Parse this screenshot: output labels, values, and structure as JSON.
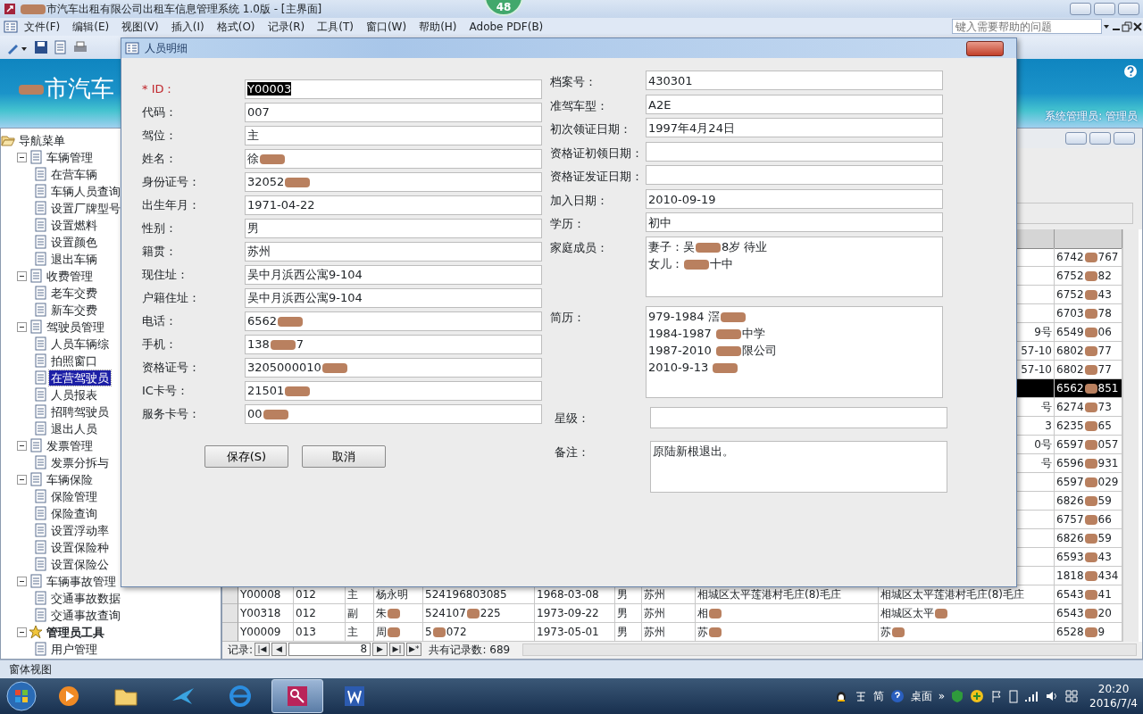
{
  "window": {
    "title": [
      {
        "kind": "redaction"
      },
      "市汽车出租有限公司出租车信息管理系统 1.0版 - [主界面]"
    ],
    "badge": "48"
  },
  "menu": [
    "文件(F)",
    "编辑(E)",
    "视图(V)",
    "插入(I)",
    "格式(O)",
    "记录(R)",
    "工具(T)",
    "窗口(W)",
    "帮助(H)",
    "Adobe PDF(B)"
  ],
  "help_box": {
    "placeholder": "键入需要帮助的问题"
  },
  "banner": {
    "title": [
      {
        "kind": "redaction"
      },
      "市汽车"
    ],
    "user": "系统管理员: 管理员"
  },
  "nav": {
    "label": "导航菜单",
    "kind": "folder",
    "selected": false,
    "expanded": true,
    "children": [
      {
        "label": "车辆管理",
        "kind": "doc",
        "selected": false,
        "expanded": true,
        "children": [
          {
            "label": "在营车辆",
            "selected": false
          },
          {
            "label": "车辆人员查询",
            "selected": false
          },
          {
            "label": "设置厂牌型号",
            "selected": false
          },
          {
            "label": "设置燃料",
            "selected": false
          },
          {
            "label": "设置颜色",
            "selected": false
          },
          {
            "label": "退出车辆",
            "selected": false
          }
        ]
      },
      {
        "label": "收费管理",
        "kind": "doc",
        "selected": false,
        "expanded": true,
        "children": [
          {
            "label": "老车交费",
            "selected": false
          },
          {
            "label": "新车交费",
            "selected": false
          }
        ]
      },
      {
        "label": "驾驶员管理",
        "kind": "doc",
        "selected": false,
        "expanded": true,
        "children": [
          {
            "label": "人员车辆综",
            "selected": false
          },
          {
            "label": "拍照窗口",
            "selected": false
          },
          {
            "label": "在营驾驶员",
            "selected": true
          },
          {
            "label": "人员报表",
            "selected": false
          },
          {
            "label": "招聘驾驶员",
            "selected": false
          },
          {
            "label": "退出人员",
            "selected": false
          }
        ]
      },
      {
        "label": "发票管理",
        "kind": "doc",
        "selected": false,
        "expanded": true,
        "children": [
          {
            "label": "发票分拆与",
            "selected": false
          }
        ]
      },
      {
        "label": "车辆保险",
        "kind": "doc",
        "selected": false,
        "expanded": true,
        "children": [
          {
            "label": "保险管理",
            "selected": false
          },
          {
            "label": "保险查询",
            "selected": false
          },
          {
            "label": "设置浮动率",
            "selected": false
          },
          {
            "label": "设置保险种",
            "selected": false
          },
          {
            "label": "设置保险公",
            "selected": false
          }
        ]
      },
      {
        "label": "车辆事故管理",
        "kind": "doc",
        "selected": false,
        "expanded": true,
        "children": [
          {
            "label": "交通事故数据",
            "selected": false
          },
          {
            "label": "交通事故查询",
            "selected": false
          }
        ]
      },
      {
        "label": "管理员工具",
        "kind": "star",
        "selected": false,
        "expanded": true,
        "children": [
          {
            "label": "用户管理",
            "selected": false
          }
        ]
      }
    ]
  },
  "datasheet": {
    "rows": [
      {
        "selected": false,
        "column_12": [
          "6742",
          {
            "kind": "redaction"
          },
          "767"
        ]
      },
      {
        "selected": false,
        "column_12": [
          "6752",
          {
            "kind": "redaction"
          },
          "82"
        ]
      },
      {
        "selected": false,
        "column_12": [
          "6752",
          {
            "kind": "redaction"
          },
          "43"
        ]
      },
      {
        "selected": false,
        "column_12": [
          "6703",
          {
            "kind": "redaction"
          },
          "78"
        ]
      },
      {
        "selected": false,
        "column_11": "9号",
        "column_12": [
          "6549",
          {
            "kind": "redaction"
          },
          "06"
        ]
      },
      {
        "selected": false,
        "column_11": "57-10",
        "column_12": [
          "6802",
          {
            "kind": "redaction"
          },
          "77"
        ]
      },
      {
        "selected": false,
        "column_11": "57-10",
        "column_12": [
          "6802",
          {
            "kind": "redaction"
          },
          "77"
        ]
      },
      {
        "selected": true,
        "column_12": [
          "6562",
          {
            "kind": "redaction"
          },
          "851"
        ]
      },
      {
        "selected": false,
        "column_11": "号",
        "column_12": [
          "6274",
          {
            "kind": "redaction"
          },
          "73"
        ]
      },
      {
        "selected": false,
        "column_11": "3",
        "column_12": [
          "6235",
          {
            "kind": "redaction"
          },
          "65"
        ]
      },
      {
        "selected": false,
        "column_11": "0号",
        "column_12": [
          "6597",
          {
            "kind": "redaction"
          },
          "057"
        ]
      },
      {
        "selected": false,
        "column_11": "号",
        "column_12": [
          "6596",
          {
            "kind": "redaction"
          },
          "931"
        ]
      },
      {
        "selected": false,
        "column_12": [
          "6597",
          {
            "kind": "redaction"
          },
          "029"
        ]
      },
      {
        "selected": false,
        "column_12": [
          "6826",
          {
            "kind": "redaction"
          },
          "59"
        ]
      },
      {
        "selected": false,
        "column_12": [
          "6757",
          {
            "kind": "redaction"
          },
          "66"
        ]
      },
      {
        "selected": false,
        "column_12": [
          "6826",
          {
            "kind": "redaction"
          },
          "59"
        ]
      },
      {
        "selected": false,
        "column_12": [
          "6593",
          {
            "kind": "redaction"
          },
          "43"
        ]
      },
      {
        "selected": false,
        "column_12": [
          "1818",
          {
            "kind": "redaction"
          },
          "434"
        ]
      },
      {
        "selected": false,
        "cells": [
          "Y00008",
          "012",
          "主",
          "杨永明",
          "524196803085",
          "1968-03-08",
          "男",
          "苏州",
          "相城区太平莲港村毛庄(8)毛庄",
          "相城区太平莲港村毛庄(8)毛庄",
          [
            "6543",
            {
              "kind": "redaction"
            },
            "41"
          ]
        ]
      },
      {
        "selected": false,
        "cells": [
          "Y00318",
          "012",
          "副",
          [
            "朱",
            {
              "kind": "redaction"
            }
          ],
          [
            "524107",
            {
              "kind": "redaction"
            },
            "225"
          ],
          "1973-09-22",
          "男",
          "苏州",
          [
            "相",
            {
              "kind": "redaction"
            }
          ],
          [
            "相城区太平",
            {
              "kind": "redaction"
            }
          ],
          [
            "6543",
            {
              "kind": "redaction"
            },
            "20"
          ]
        ]
      },
      {
        "selected": false,
        "cells": [
          "Y00009",
          "013",
          "主",
          [
            "周",
            {
              "kind": "redaction"
            }
          ],
          [
            "5",
            {
              "kind": "redaction"
            },
            "072"
          ],
          "1973-05-01",
          "男",
          "苏州",
          [
            "苏",
            {
              "kind": "redaction"
            }
          ],
          [
            "苏",
            {
              "kind": "redaction"
            }
          ],
          [
            "6528",
            {
              "kind": "redaction"
            },
            "9"
          ]
        ]
      }
    ],
    "record_nav": {
      "label": "记录:",
      "buttons": [
        "|◀",
        "◀",
        "▶",
        "▶|",
        "▶*"
      ],
      "current": "8",
      "total": "共有记录数: 689"
    }
  },
  "dialog": {
    "title": "人员明细",
    "left_fields": [
      {
        "label": "* ID：",
        "required": true,
        "value": [
          "Y00003"
        ],
        "text_selected": true
      },
      {
        "label": "代码：",
        "value": [
          "007"
        ]
      },
      {
        "label": "驾位：",
        "value": [
          "主"
        ]
      },
      {
        "label": "姓名：",
        "value": [
          "徐",
          {
            "kind": "redaction"
          }
        ]
      },
      {
        "label": "身份证号：",
        "value": [
          "32052",
          {
            "kind": "redaction"
          }
        ]
      },
      {
        "label": "出生年月：",
        "value": [
          "1971-04-22"
        ]
      },
      {
        "label": "性别：",
        "value": [
          "男"
        ]
      },
      {
        "label": "籍贯：",
        "value": [
          "苏州"
        ]
      },
      {
        "label": "现住址：",
        "value": [
          "吴中月浜西公寓9-104"
        ]
      },
      {
        "label": "户籍住址：",
        "value": [
          "吴中月浜西公寓9-104"
        ]
      },
      {
        "label": "电话：",
        "value": [
          "6562",
          {
            "kind": "redaction"
          }
        ]
      },
      {
        "label": "手机：",
        "value": [
          "138",
          {
            "kind": "redaction"
          },
          "7"
        ]
      },
      {
        "label": "资格证号：",
        "value": [
          "3205000010",
          {
            "kind": "redaction"
          }
        ]
      },
      {
        "label": "IC卡号：",
        "value": [
          "21501",
          {
            "kind": "redaction"
          }
        ]
      },
      {
        "label": "服务卡号：",
        "value": [
          "00",
          {
            "kind": "redaction"
          }
        ]
      }
    ],
    "buttons": [
      "保存(S)",
      "取消"
    ],
    "right_fields": [
      {
        "label": "档案号：",
        "kind": "line",
        "lines": [
          [
            "430301"
          ]
        ]
      },
      {
        "label": "准驾车型：",
        "kind": "line",
        "lines": [
          [
            "A2E"
          ]
        ]
      },
      {
        "label": "初次领证日期：",
        "kind": "line",
        "lines": [
          [
            "1997年4月24日"
          ]
        ]
      },
      {
        "label": "资格证初领日期：",
        "kind": "line"
      },
      {
        "label": "资格证发证日期：",
        "kind": "line"
      },
      {
        "label": "加入日期：",
        "kind": "line",
        "lines": [
          [
            "2010-09-19"
          ]
        ]
      },
      {
        "label": "学历：",
        "kind": "line",
        "lines": [
          [
            "初中"
          ]
        ]
      },
      {
        "label": "家庭成员：",
        "kind": "memo",
        "lines": [
          [
            "妻子：吴",
            {
              "kind": "redaction"
            },
            "8岁 待业"
          ],
          [
            "女儿：",
            {
              "kind": "redaction"
            },
            "十中"
          ]
        ]
      },
      {
        "label": "简历：",
        "kind": "tall",
        "lines": [
          [
            "979-1984 滘",
            {
              "kind": "redaction"
            }
          ],
          [
            "1984-1987 ",
            {
              "kind": "redaction"
            },
            "中学"
          ],
          [
            "1987-2010 ",
            {
              "kind": "redaction"
            },
            "限公司"
          ],
          [
            "2010-9-13 ",
            {
              "kind": "redaction"
            }
          ]
        ]
      },
      {
        "label": "星级：",
        "kind": "line2"
      },
      {
        "label": "备注：",
        "kind": "memo2",
        "lines": [
          [
            "原陆新根退出。"
          ]
        ]
      }
    ]
  },
  "status_bar": "窗体视图",
  "taskbar": {
    "tray_texts": [
      "简",
      "桌面",
      "»"
    ],
    "time": "20:20",
    "date": "2016/7/4"
  }
}
